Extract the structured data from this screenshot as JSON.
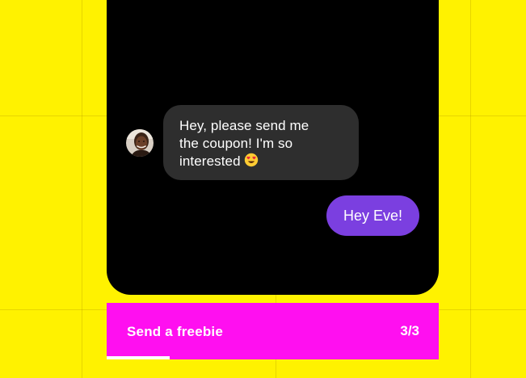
{
  "colors": {
    "background": "#FFF200",
    "phone_screen": "#000000",
    "incoming_bubble": "#2E2E2E",
    "outgoing_bubble": "#7B3FE0",
    "cta_background": "#FF0FF0",
    "text": "#FFFFFF"
  },
  "chat": {
    "incoming": {
      "avatar_icon": "user-avatar",
      "lines": [
        "Hey, please send me",
        "the coupon! I'm so",
        "interested"
      ],
      "emoji_icon": "heart-eyes-emoji"
    },
    "outgoing": {
      "text": "Hey Eve!"
    }
  },
  "cta": {
    "label": "Send a freebie",
    "counter": "3/3",
    "progress_percent": 19
  }
}
